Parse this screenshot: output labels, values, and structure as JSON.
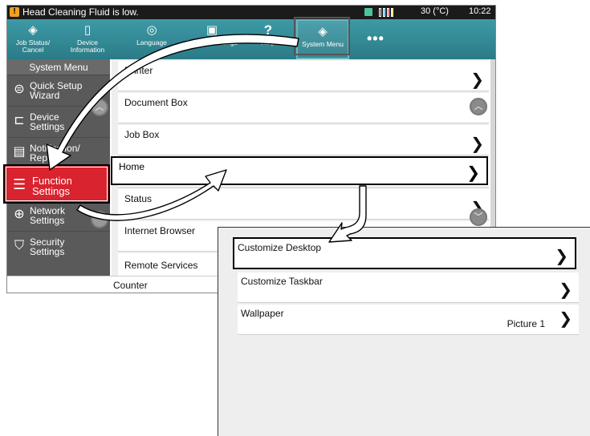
{
  "status_bar": {
    "warning_icon": "!",
    "message": "Head Cleaning Fluid is low.",
    "temperature": "30 (°C)",
    "time": "10:22",
    "toner_colors": [
      "#2a2a2a",
      "#1ea0d6",
      "#d6307e",
      "#e8d21a"
    ]
  },
  "toolbar": {
    "items": [
      {
        "label_1": "Job Status/",
        "label_2": "Cancel",
        "icon": "job-status-icon"
      },
      {
        "label_1": "Device",
        "label_2": "Information",
        "icon": "device-info-icon"
      },
      {
        "label_1": "Language",
        "icon": "language-icon"
      },
      {
        "label_1": "Favorite Settings",
        "icon": "favorites-icon"
      },
      {
        "label_1": "Help",
        "icon": "help-icon"
      },
      {
        "label_1": "System Menu",
        "icon": "system-menu-icon"
      }
    ],
    "more": "•••"
  },
  "sidebar": {
    "title": "System Menu",
    "items": [
      {
        "line1": "Quick Setup",
        "line2": "Wizard",
        "icon": "wizard-icon"
      },
      {
        "line1": "Device",
        "line2": "Settings",
        "icon": "device-settings-icon"
      },
      {
        "line1": "Notification/",
        "line2": "Report",
        "icon": "report-icon"
      },
      {
        "line1": "Function",
        "line2": "Settings",
        "icon": "function-settings-icon"
      },
      {
        "line1": "Network",
        "line2": "Settings",
        "icon": "network-icon"
      },
      {
        "line1": "Security",
        "line2": "Settings",
        "icon": "security-icon"
      }
    ]
  },
  "list": {
    "items": [
      "Printer",
      "Document Box",
      "Job Box",
      "Home",
      "Status",
      "Internet Browser",
      "Remote Services"
    ]
  },
  "footer": {
    "counter": "Counter"
  },
  "popup": {
    "items": [
      {
        "label": "Customize Desktop",
        "value": ""
      },
      {
        "label": "Customize Taskbar",
        "value": ""
      },
      {
        "label": "Wallpaper",
        "value": "Picture 1"
      }
    ]
  },
  "chevron": "❯",
  "accent_red": "#d9232e",
  "toolbar_teal": "#2a7b87"
}
